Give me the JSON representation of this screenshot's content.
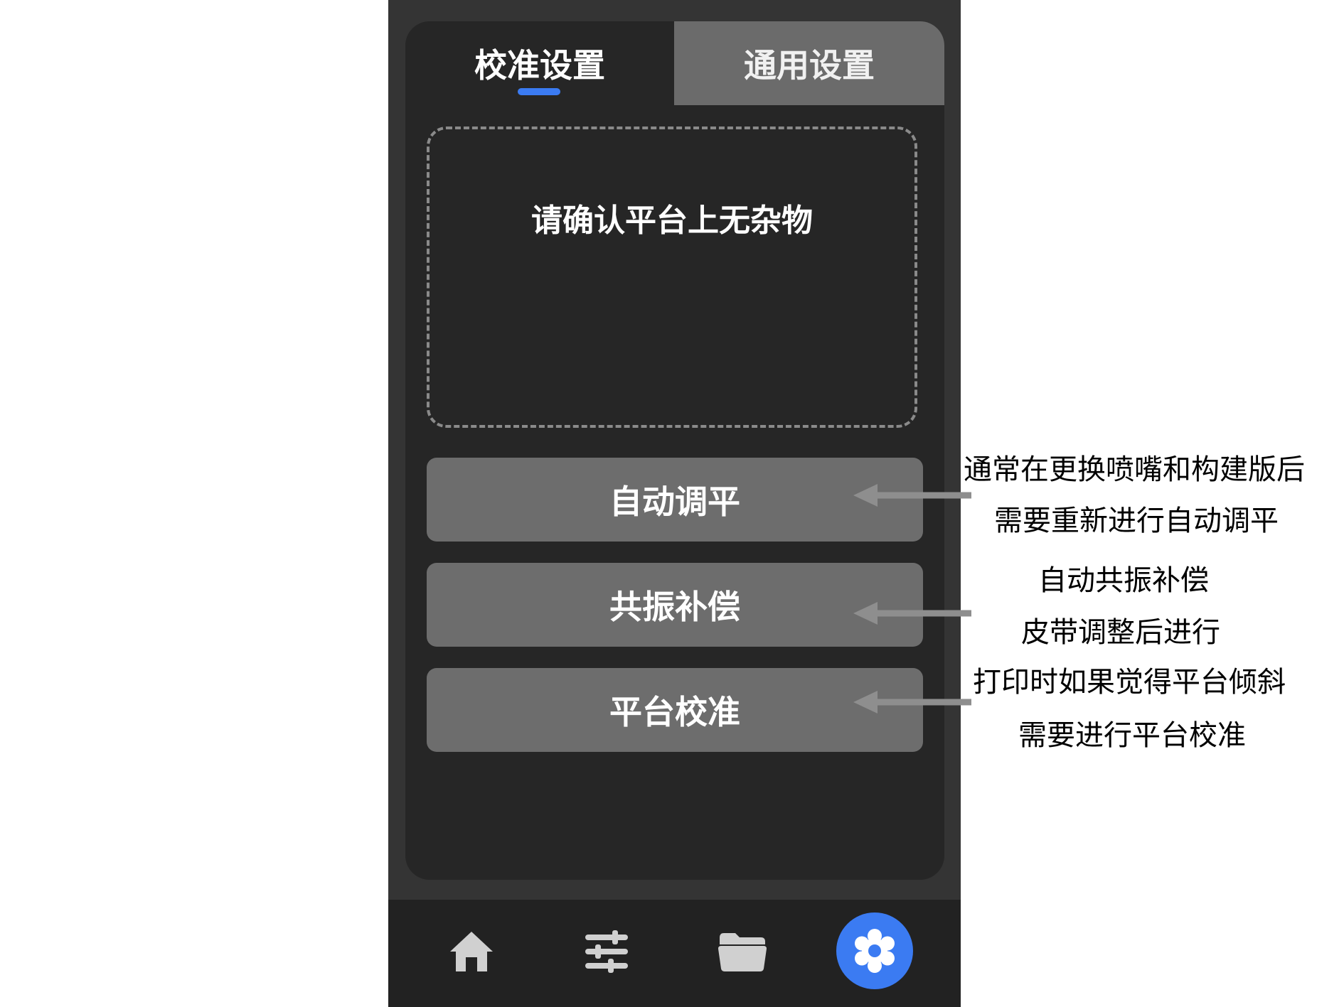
{
  "tabs": {
    "calibration": "校准设置",
    "general": "通用设置"
  },
  "preview": {
    "message": "请确认平台上无杂物"
  },
  "actions": {
    "auto_level": "自动调平",
    "resonance": "共振补偿",
    "platform_calibration": "平台校准"
  },
  "bottom_nav": {
    "items": [
      "home-icon",
      "sliders-icon",
      "folder-icon",
      "gear-icon"
    ],
    "active": "gear-icon"
  },
  "annotations": {
    "auto_level_line1": "通常在更换喷嘴和构建版后",
    "auto_level_line2": "需要重新进行自动调平",
    "resonance_line1": "自动共振补偿",
    "resonance_line2": "皮带调整后进行",
    "platform_line1": "打印时如果觉得平台倾斜",
    "platform_line2": "需要进行平台校准"
  },
  "colors": {
    "accent": "#3b7bf2",
    "panel": "#262626",
    "button": "#6d6d6d",
    "arrow": "#8e8e8e"
  }
}
